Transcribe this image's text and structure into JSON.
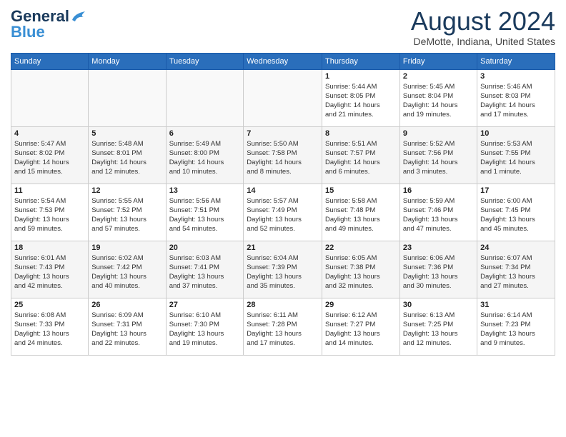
{
  "header": {
    "logo_line1": "General",
    "logo_line2": "Blue",
    "month_title": "August 2024",
    "location": "DeMotte, Indiana, United States"
  },
  "weekdays": [
    "Sunday",
    "Monday",
    "Tuesday",
    "Wednesday",
    "Thursday",
    "Friday",
    "Saturday"
  ],
  "weeks": [
    [
      {
        "day": "",
        "info": ""
      },
      {
        "day": "",
        "info": ""
      },
      {
        "day": "",
        "info": ""
      },
      {
        "day": "",
        "info": ""
      },
      {
        "day": "1",
        "info": "Sunrise: 5:44 AM\nSunset: 8:05 PM\nDaylight: 14 hours\nand 21 minutes."
      },
      {
        "day": "2",
        "info": "Sunrise: 5:45 AM\nSunset: 8:04 PM\nDaylight: 14 hours\nand 19 minutes."
      },
      {
        "day": "3",
        "info": "Sunrise: 5:46 AM\nSunset: 8:03 PM\nDaylight: 14 hours\nand 17 minutes."
      }
    ],
    [
      {
        "day": "4",
        "info": "Sunrise: 5:47 AM\nSunset: 8:02 PM\nDaylight: 14 hours\nand 15 minutes."
      },
      {
        "day": "5",
        "info": "Sunrise: 5:48 AM\nSunset: 8:01 PM\nDaylight: 14 hours\nand 12 minutes."
      },
      {
        "day": "6",
        "info": "Sunrise: 5:49 AM\nSunset: 8:00 PM\nDaylight: 14 hours\nand 10 minutes."
      },
      {
        "day": "7",
        "info": "Sunrise: 5:50 AM\nSunset: 7:58 PM\nDaylight: 14 hours\nand 8 minutes."
      },
      {
        "day": "8",
        "info": "Sunrise: 5:51 AM\nSunset: 7:57 PM\nDaylight: 14 hours\nand 6 minutes."
      },
      {
        "day": "9",
        "info": "Sunrise: 5:52 AM\nSunset: 7:56 PM\nDaylight: 14 hours\nand 3 minutes."
      },
      {
        "day": "10",
        "info": "Sunrise: 5:53 AM\nSunset: 7:55 PM\nDaylight: 14 hours\nand 1 minute."
      }
    ],
    [
      {
        "day": "11",
        "info": "Sunrise: 5:54 AM\nSunset: 7:53 PM\nDaylight: 13 hours\nand 59 minutes."
      },
      {
        "day": "12",
        "info": "Sunrise: 5:55 AM\nSunset: 7:52 PM\nDaylight: 13 hours\nand 57 minutes."
      },
      {
        "day": "13",
        "info": "Sunrise: 5:56 AM\nSunset: 7:51 PM\nDaylight: 13 hours\nand 54 minutes."
      },
      {
        "day": "14",
        "info": "Sunrise: 5:57 AM\nSunset: 7:49 PM\nDaylight: 13 hours\nand 52 minutes."
      },
      {
        "day": "15",
        "info": "Sunrise: 5:58 AM\nSunset: 7:48 PM\nDaylight: 13 hours\nand 49 minutes."
      },
      {
        "day": "16",
        "info": "Sunrise: 5:59 AM\nSunset: 7:46 PM\nDaylight: 13 hours\nand 47 minutes."
      },
      {
        "day": "17",
        "info": "Sunrise: 6:00 AM\nSunset: 7:45 PM\nDaylight: 13 hours\nand 45 minutes."
      }
    ],
    [
      {
        "day": "18",
        "info": "Sunrise: 6:01 AM\nSunset: 7:43 PM\nDaylight: 13 hours\nand 42 minutes."
      },
      {
        "day": "19",
        "info": "Sunrise: 6:02 AM\nSunset: 7:42 PM\nDaylight: 13 hours\nand 40 minutes."
      },
      {
        "day": "20",
        "info": "Sunrise: 6:03 AM\nSunset: 7:41 PM\nDaylight: 13 hours\nand 37 minutes."
      },
      {
        "day": "21",
        "info": "Sunrise: 6:04 AM\nSunset: 7:39 PM\nDaylight: 13 hours\nand 35 minutes."
      },
      {
        "day": "22",
        "info": "Sunrise: 6:05 AM\nSunset: 7:38 PM\nDaylight: 13 hours\nand 32 minutes."
      },
      {
        "day": "23",
        "info": "Sunrise: 6:06 AM\nSunset: 7:36 PM\nDaylight: 13 hours\nand 30 minutes."
      },
      {
        "day": "24",
        "info": "Sunrise: 6:07 AM\nSunset: 7:34 PM\nDaylight: 13 hours\nand 27 minutes."
      }
    ],
    [
      {
        "day": "25",
        "info": "Sunrise: 6:08 AM\nSunset: 7:33 PM\nDaylight: 13 hours\nand 24 minutes."
      },
      {
        "day": "26",
        "info": "Sunrise: 6:09 AM\nSunset: 7:31 PM\nDaylight: 13 hours\nand 22 minutes."
      },
      {
        "day": "27",
        "info": "Sunrise: 6:10 AM\nSunset: 7:30 PM\nDaylight: 13 hours\nand 19 minutes."
      },
      {
        "day": "28",
        "info": "Sunrise: 6:11 AM\nSunset: 7:28 PM\nDaylight: 13 hours\nand 17 minutes."
      },
      {
        "day": "29",
        "info": "Sunrise: 6:12 AM\nSunset: 7:27 PM\nDaylight: 13 hours\nand 14 minutes."
      },
      {
        "day": "30",
        "info": "Sunrise: 6:13 AM\nSunset: 7:25 PM\nDaylight: 13 hours\nand 12 minutes."
      },
      {
        "day": "31",
        "info": "Sunrise: 6:14 AM\nSunset: 7:23 PM\nDaylight: 13 hours\nand 9 minutes."
      }
    ]
  ]
}
